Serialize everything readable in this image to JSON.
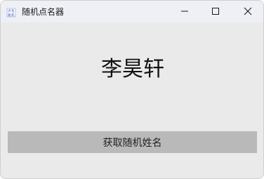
{
  "window": {
    "title": "随机点名器",
    "app_icon": "dice-app-icon"
  },
  "controls": {
    "minimize_icon": "minimize-icon",
    "maximize_icon": "maximize-icon",
    "close_icon": "close-icon"
  },
  "main": {
    "current_name": "李昊轩",
    "button_label": "获取随机姓名"
  },
  "colors": {
    "window_bg": "#eaeaea",
    "titlebar_bg": "#eef0f6",
    "button_bg": "#b9b9b9",
    "text": "#111111"
  }
}
